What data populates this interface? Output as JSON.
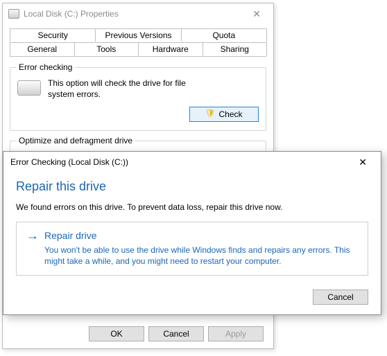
{
  "properties_window": {
    "title": "Local Disk (C:) Properties",
    "tabs_row1": [
      "Security",
      "Previous Versions",
      "Quota"
    ],
    "tabs_row2": [
      "General",
      "Tools",
      "Hardware",
      "Sharing"
    ],
    "active_tab": "Tools",
    "error_checking_group": {
      "title": "Error checking",
      "description": "This option will check the drive for file system errors.",
      "button_label": "Check"
    },
    "optimize_group": {
      "title": "Optimize and defragment drive"
    },
    "buttons": {
      "ok": "OK",
      "cancel": "Cancel",
      "apply": "Apply"
    }
  },
  "error_dialog": {
    "title": "Error Checking (Local Disk (C:))",
    "heading": "Repair this drive",
    "message": "We found errors on this drive. To prevent data loss, repair this drive now.",
    "command": {
      "title": "Repair drive",
      "description": "You won't be able to use the drive while Windows finds and repairs any errors. This might take a while, and you might need to restart your computer."
    },
    "cancel_label": "Cancel"
  }
}
